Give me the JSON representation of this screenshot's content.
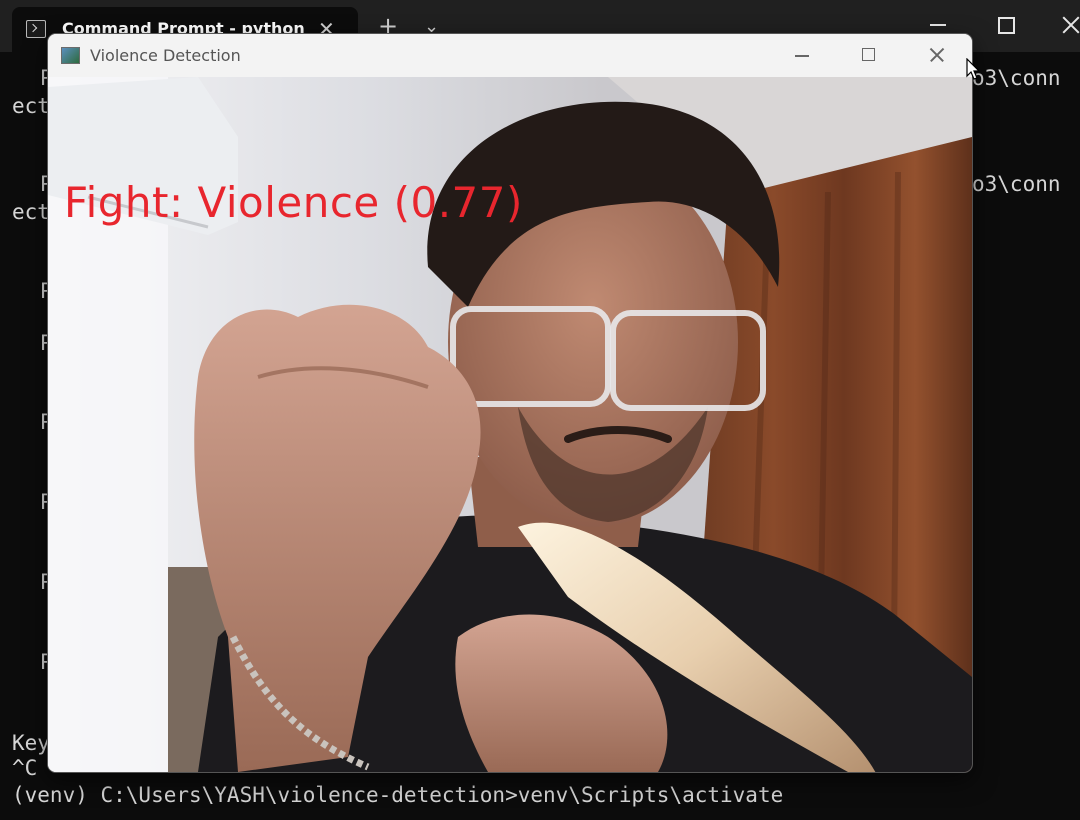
{
  "terminal": {
    "tab_title": "Command Prompt - python",
    "tab_close_glyph": "✕",
    "new_tab_glyph": "+",
    "dropdown_glyph": "⌄",
    "lines": {
      "l1a": "P",
      "l1b": "o3\\conn",
      "l1c": "ect",
      "l2a": "P",
      "l2b": "o3\\conn",
      "l2c": "ect",
      "p1": "P",
      "p2": "P",
      "p3": "P",
      "p4": "P",
      "p5": "P",
      "p6": "P",
      "key": "Key",
      "ctrlc": "^C",
      "prompt": "(venv) C:\\Users\\YASH\\violence-detection>venv\\Scripts\\activate"
    }
  },
  "detection_window": {
    "title": "Violence Detection",
    "overlay_label": "Fight: Violence (0.77)",
    "overlay_color": "#e8262e"
  },
  "icons": {
    "terminal_tab": "terminal-icon",
    "app": "app-window-icon",
    "minimize": "minimize-icon",
    "maximize": "maximize-icon",
    "close": "close-icon",
    "cursor": "mouse-cursor-icon"
  }
}
